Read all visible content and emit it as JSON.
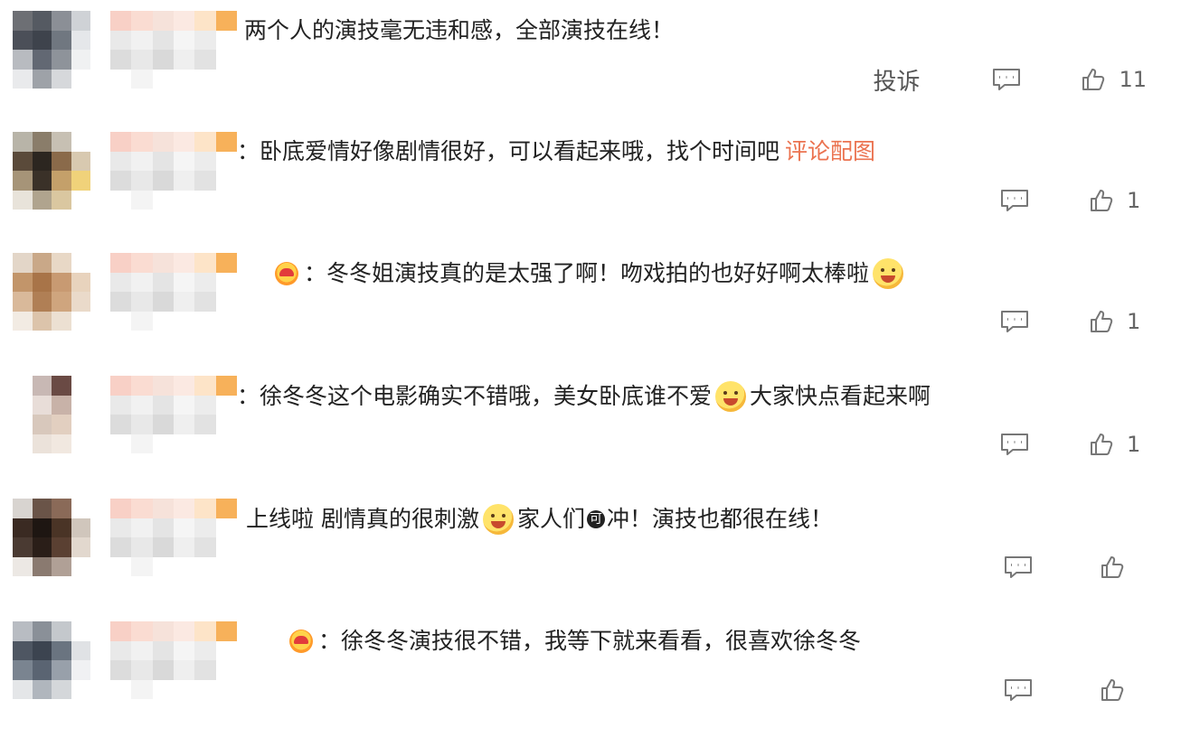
{
  "actions": {
    "report_label": "投诉"
  },
  "comments": [
    {
      "segments": [
        {
          "kind": "text",
          "value": "两个人的演技毫无违和感，全部演技在线！"
        }
      ],
      "likes": "11"
    },
    {
      "segments": [
        {
          "kind": "text",
          "value": "：卧底爱情好像剧情很好，可以看起来哦，找个时间吧"
        },
        {
          "kind": "link",
          "value": "评论配图"
        }
      ],
      "likes": "1"
    },
    {
      "badge": "heart-face-badge-icon",
      "segments": [
        {
          "kind": "text",
          "value": "：冬冬姐演技真的是太强了啊！吻戏拍的也好好啊太棒啦"
        },
        {
          "kind": "emoji",
          "value": "party-face-emoji-icon"
        }
      ],
      "likes": "1"
    },
    {
      "segments": [
        {
          "kind": "text",
          "value": "：徐冬冬这个电影确实不错哦，美女卧底谁不爱"
        },
        {
          "kind": "emoji",
          "value": "adore-face-emoji-icon"
        },
        {
          "kind": "text",
          "value": "大家快点看起来啊"
        }
      ],
      "likes": "1"
    },
    {
      "segments": [
        {
          "kind": "text",
          "value": "上线啦 剧情真的很刺激"
        },
        {
          "kind": "emoji",
          "value": "yummy-face-emoji-icon"
        },
        {
          "kind": "text",
          "value": " 家人们"
        },
        {
          "kind": "glyph",
          "value": "可"
        },
        {
          "kind": "text",
          "value": "冲！演技也都很在线！"
        }
      ],
      "likes": ""
    },
    {
      "badge": "heart-face-badge-icon",
      "segments": [
        {
          "kind": "text",
          "value": "：徐冬冬演技很不错，我等下就来看看，很喜欢徐冬冬"
        }
      ],
      "likes": ""
    }
  ],
  "colors": {
    "link": "#eb7350",
    "icon": "#777777"
  }
}
